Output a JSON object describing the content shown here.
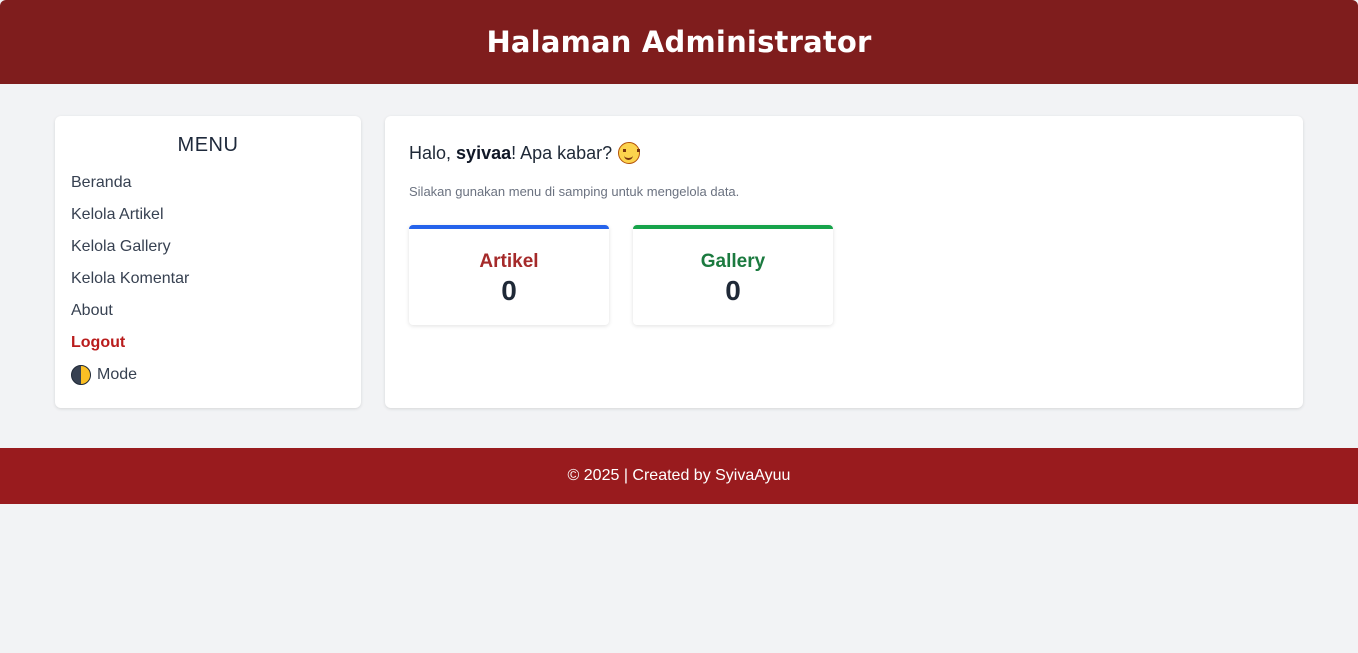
{
  "header": {
    "title": "Halaman Administrator"
  },
  "sidebar": {
    "title": "MENU",
    "items": [
      {
        "label": "Beranda"
      },
      {
        "label": "Kelola Artikel"
      },
      {
        "label": "Kelola Gallery"
      },
      {
        "label": "Kelola Komentar"
      },
      {
        "label": "About"
      },
      {
        "label": "Logout"
      },
      {
        "label": "Mode",
        "icon": "half-moon-icon"
      }
    ]
  },
  "main": {
    "greeting_prefix": "Halo,",
    "username": "syivaa",
    "greeting_suffix": "! Apa kabar?",
    "greeting_icon": "smiley-icon",
    "subtext": "Silakan gunakan menu di samping untuk mengelola data.",
    "cards": [
      {
        "label": "Artikel",
        "value": "0",
        "accent": "#2563eb"
      },
      {
        "label": "Gallery",
        "value": "0",
        "accent": "#16a34a"
      }
    ]
  },
  "footer": {
    "text": "© 2025 | Created by SyivaAyuu"
  },
  "colors": {
    "header": "#7f1d1d",
    "footer": "#991b1e",
    "logout": "#b91c1c"
  }
}
